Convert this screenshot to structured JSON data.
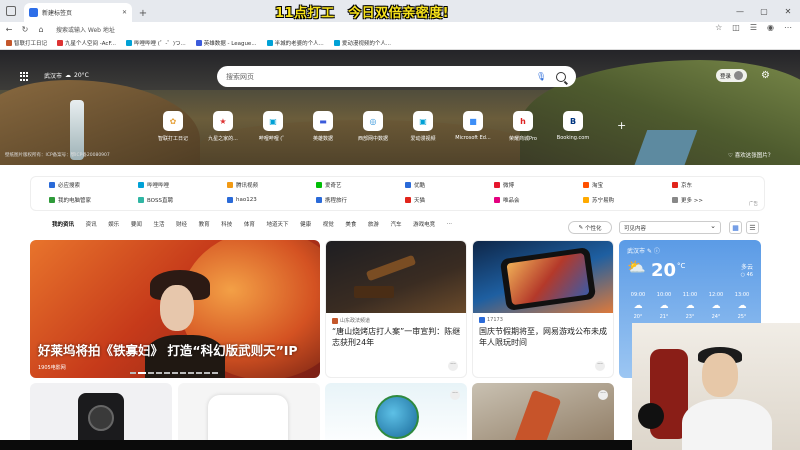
{
  "overlay_caption": "11点打工　今日双倍亲密度!",
  "tab": {
    "title": "新建标签页",
    "new_tab": "+"
  },
  "window_controls": [
    "—",
    "▢",
    "✕"
  ],
  "address": {
    "placeholder": "搜索或输入 Web 地址"
  },
  "bookmarks": [
    "智联打工日记",
    "九星个人空间 -AcF...",
    "哔哩哔哩 (゜-゜)つ...",
    "英雄数据 - League...",
    "半城的老婆的个人...",
    "爱动漫视频的个人..."
  ],
  "hero": {
    "city": "武汉市",
    "temp": "20°C",
    "search_placeholder": "搜索网页",
    "login": "登录",
    "copyright": "壁纸图片版权所有：ICP备案号：鄂ICP备20080907",
    "likes_text": "喜欢这张图片？"
  },
  "quick_tiles": [
    {
      "label": "智联打工日记",
      "glyph": "✿",
      "color": "#e6a23c"
    },
    {
      "label": "九星之家的...",
      "glyph": "★",
      "color": "#d33"
    },
    {
      "label": "哔哩哔哩 (゜",
      "glyph": "▣",
      "color": "#00a1d6"
    },
    {
      "label": "英雄数据",
      "glyph": "▬",
      "color": "#3b5bdb"
    },
    {
      "label": "西部网中数据",
      "glyph": "◎",
      "color": "#2b90d9"
    },
    {
      "label": "爱动漫视频",
      "glyph": "▣",
      "color": "#00a1d6"
    },
    {
      "label": "Microsoft Ed...",
      "glyph": "■",
      "color": "#3d8ef7"
    },
    {
      "label": "荣耀商城Pro",
      "glyph": "h",
      "color": "#d22"
    },
    {
      "label": "Booking.com",
      "glyph": "B",
      "color": "#003580"
    }
  ],
  "links_row1": [
    {
      "t": "必应搜索",
      "c": "#2a6ad8"
    },
    {
      "t": "哔哩哔哩",
      "c": "#00a1d6"
    },
    {
      "t": "腾讯视频",
      "c": "#f29a14"
    },
    {
      "t": "爱奇艺",
      "c": "#00be06"
    },
    {
      "t": "优酷",
      "c": "#2a6ad8"
    },
    {
      "t": "微博",
      "c": "#e6162d"
    },
    {
      "t": "淘宝",
      "c": "#ff5000"
    },
    {
      "t": "京东",
      "c": "#e1251b"
    }
  ],
  "links_row2": [
    {
      "t": "我的电脑管家",
      "c": "#2f9b3a"
    },
    {
      "t": "BOSS直聘",
      "c": "#30b6a4"
    },
    {
      "t": "hao123",
      "c": "#2a6ad8"
    },
    {
      "t": "携程旅行",
      "c": "#2a6ad8"
    },
    {
      "t": "天猫",
      "c": "#e1251b"
    },
    {
      "t": "唯品会",
      "c": "#e4007f"
    },
    {
      "t": "苏宁易购",
      "c": "#ffaa00"
    },
    {
      "t": "更多 >>",
      "c": "#888"
    }
  ],
  "ad_label": "广告",
  "channels": [
    "我的资讯",
    "资讯",
    "娱乐",
    "要闻",
    "生活",
    "财经",
    "教育",
    "科技",
    "体育",
    "地道天下",
    "健康",
    "视觉",
    "美食",
    "旅游",
    "汽车",
    "游戏电竞",
    "..."
  ],
  "personalize": "个性化",
  "visible_content": "可见内容",
  "feed": {
    "big": {
      "title": "好莱坞将拍《铁寡妇》 打造“科幻版武则天”IP",
      "source": "1905电影网"
    },
    "news1": {
      "source": "山东政法频道",
      "title": "“唐山烧烤店打人案”一审宣判：陈继志获刑24年"
    },
    "news2": {
      "source": "17173",
      "title": "国庆节假期将至，网易游戏公布未成年人限玩时间"
    }
  },
  "weather_card": {
    "city": "武汉市",
    "temp": "20",
    "unit": "°C",
    "condition": "多云",
    "aqi": "○ 46",
    "hours": [
      {
        "time": "09:00",
        "temp": "20°"
      },
      {
        "time": "10:00",
        "temp": "21°"
      },
      {
        "time": "11:00",
        "temp": "23°"
      },
      {
        "time": "12:00",
        "temp": "24°"
      },
      {
        "time": "13:00",
        "temp": "25°"
      }
    ]
  },
  "more_glyph": "···"
}
